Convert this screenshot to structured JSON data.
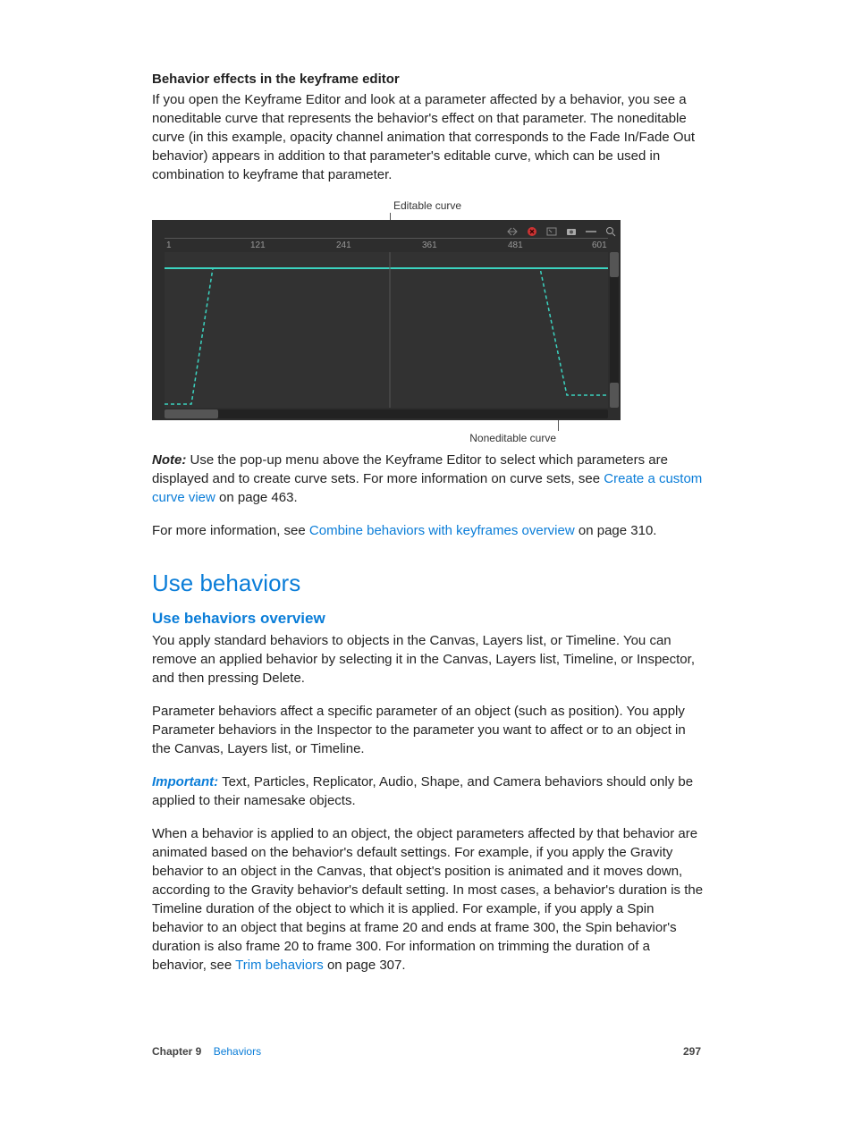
{
  "section_title": "Behavior effects in the keyframe editor",
  "intro_para": "If you open the Keyframe Editor and look at a parameter affected by a behavior, you see a noneditable curve that represents the behavior's effect on that parameter. The noneditable curve (in this example, opacity channel animation that corresponds to the Fade In/Fade Out behavior) appears in addition to that parameter's editable curve, which can be used in combination to keyframe that parameter.",
  "fig": {
    "top_callout": "Editable curve",
    "bottom_callout": "Noneditable curve",
    "ruler_ticks": [
      "1",
      "121",
      "241",
      "361",
      "481",
      "601"
    ]
  },
  "note": {
    "label": "Note:",
    "before_link": "Use the pop-up menu above the Keyframe Editor to select which parameters are displayed and to create curve sets. For more information on curve sets, see ",
    "link_text": "Create a custom curve view",
    "after_link": " on page 463."
  },
  "more_info": {
    "before": "For more information, see ",
    "link_text": "Combine behaviors with keyframes overview",
    "after": " on page 310."
  },
  "h1": "Use behaviors",
  "h2": "Use behaviors overview",
  "para1": "You apply standard behaviors to objects in the Canvas, Layers list, or Timeline. You can remove an applied behavior by selecting it in the Canvas, Layers list, Timeline, or Inspector, and then pressing Delete.",
  "para2": "Parameter behaviors affect a specific parameter of an object (such as position). You apply Parameter behaviors in the Inspector to the parameter you want to affect or to an object in the Canvas, Layers list, or Timeline.",
  "important": {
    "label": "Important:",
    "text": "Text, Particles, Replicator, Audio, Shape, and Camera behaviors should only be applied to their namesake objects."
  },
  "para3": {
    "before": "When a behavior is applied to an object, the object parameters affected by that behavior are animated based on the behavior's default settings. For example, if you apply the Gravity behavior to an object in the Canvas, that object's position is animated and it moves down, according to the Gravity behavior's default setting. In most cases, a behavior's duration is the Timeline duration of the object to which it is applied. For example, if you apply a Spin behavior to an object that begins at frame 20 and ends at frame 300, the Spin behavior's duration is also frame 20 to frame 300. For information on trimming the duration of a behavior, see ",
    "link_text": "Trim behaviors",
    "after": " on page 307."
  },
  "footer": {
    "chapter_label": "Chapter 9",
    "chapter_link": "Behaviors",
    "page_number": "297"
  }
}
